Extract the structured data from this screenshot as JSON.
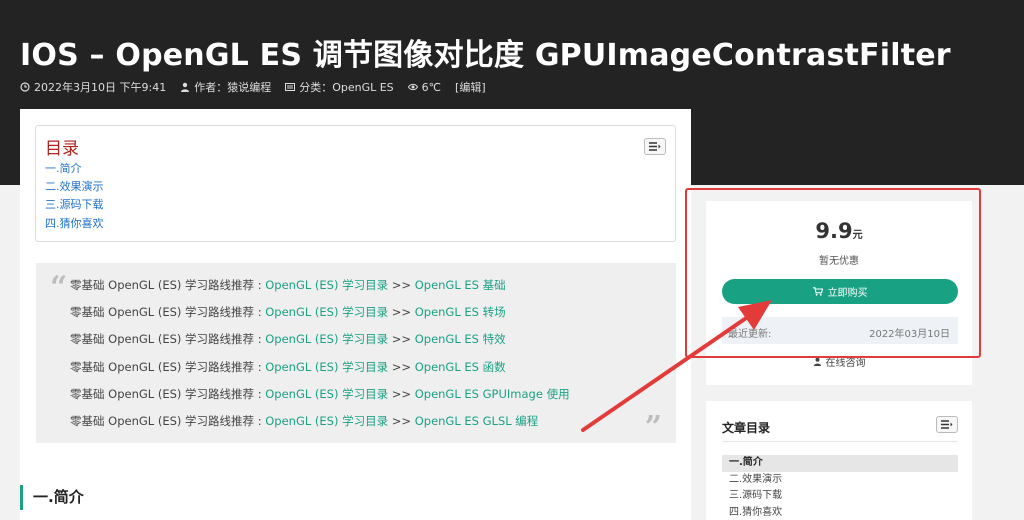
{
  "post": {
    "title": "IOS  –  OpenGL ES 调节图像对比度 GPUImageContrastFilter",
    "meta": {
      "date": "2022年3月10日 下午9:41",
      "author": "作者：猿说编程",
      "category": "分类：OpenGL ES",
      "views": "6℃",
      "edit": "[编辑]"
    }
  },
  "toc": {
    "title": "目录",
    "items": [
      "一.简介",
      "二.效果演示",
      "三.源码下载",
      "四.猜你喜欢"
    ]
  },
  "quote": {
    "prefix": "零基础 OpenGL (ES) 学习路线推荐 : ",
    "catalog_link": "OpenGL (ES) 学习目录",
    "separator": " >> ",
    "links": [
      "OpenGL ES 基础",
      "OpenGL ES 转场",
      "OpenGL ES 特效",
      "OpenGL ES 函数",
      "OpenGL ES GPUImage 使用",
      "OpenGL ES GLSL 编程"
    ]
  },
  "section": {
    "heading": "一.简介"
  },
  "purchase": {
    "price": "9.9",
    "unit": "元",
    "discount": "暂无优惠",
    "buy_label": "立即购买",
    "update_label": "最近更新:",
    "update_date": "2022年03月10日",
    "consult": "在线咨询"
  },
  "article_toc": {
    "title": "文章目录",
    "items": [
      "一.简介",
      "二.效果演示",
      "三.源码下载",
      "四.猜你喜欢"
    ]
  },
  "colors": {
    "accent": "#1aa184",
    "highlight": "#e33a3a",
    "toc_title": "#b0231f",
    "link": "#1f72c9",
    "header_bg": "#232323"
  }
}
